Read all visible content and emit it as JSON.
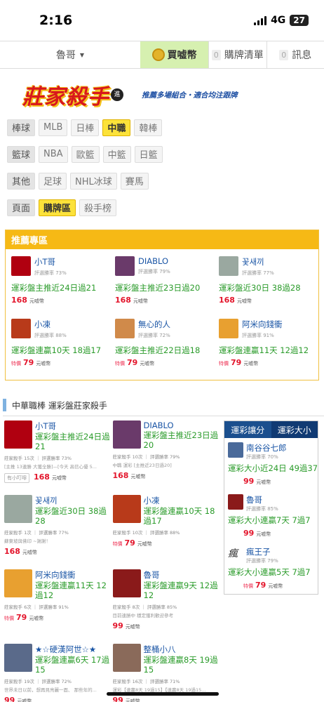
{
  "status": {
    "time": "2:16",
    "network": "4G",
    "battery": "27"
  },
  "nav": {
    "user": "魯哥",
    "buy": "買嘘幣",
    "list_count": "0",
    "list_label": "購牌清單",
    "msg_count": "0",
    "msg_label": "訊息"
  },
  "banner": {
    "logo": "莊家殺手",
    "badge": "進",
    "tagline": "推薦多場組合・適合均注跟牌"
  },
  "categories": [
    {
      "head": "棒球",
      "items": [
        "MLB",
        "日棒",
        "中職",
        "韓棒"
      ],
      "active": "中職"
    },
    {
      "head": "籃球",
      "items": [
        "NBA",
        "歐籃",
        "中籃",
        "日籃"
      ]
    },
    {
      "head": "其他",
      "items": [
        "足球",
        "NHL冰球",
        "賽馬"
      ]
    },
    {
      "head": "頁面",
      "items": [
        "購牌區",
        "殺手榜"
      ],
      "active": "購牌區"
    }
  ],
  "recommend": {
    "title": "推薦專區",
    "special": "特價",
    "unit": "元嘘幣",
    "cards": [
      {
        "name": "小T哥",
        "rate": "評選勝率 73%",
        "title": "運彩盤主推近24日過21",
        "price": "168",
        "special": false,
        "color": "#b00010"
      },
      {
        "name": "DIABLO",
        "rate": "評選勝率 79%",
        "title": "運彩盤主推近23日過20",
        "price": "168",
        "special": false,
        "color": "#6a3a6a"
      },
      {
        "name": "꽃새끼",
        "rate": "評選勝率 77%",
        "title": "運彩盤近30日 38過28",
        "price": "168",
        "special": false,
        "color": "#9aa8a0"
      },
      {
        "name": "小凍",
        "rate": "評選勝率 88%",
        "title": "運彩盤連贏10天 18過17",
        "price": "79",
        "special": true,
        "color": "#b83a1a"
      },
      {
        "name": "無心的人",
        "rate": "評選勝率 72%",
        "title": "運彩盤主推近22日過18",
        "price": "79",
        "special": true,
        "color": "#d08a4a"
      },
      {
        "name": "阿米向錢衝",
        "rate": "評選勝率 91%",
        "title": "運彩盤連贏11天 12過12",
        "price": "79",
        "special": true,
        "color": "#e8a030"
      }
    ]
  },
  "section": {
    "title": "中華職棒 運彩盤莊家殺手"
  },
  "list": {
    "special": "特價",
    "unit": "元嘘幣",
    "rows": [
      [
        {
          "name": "小T哥",
          "title": "運彩盤主推近24日過21",
          "meta": "莊家殺手 15次 ｜ 評選勝率 73%",
          "desc": "[主推 13連勝 大獲全勝]—[今天 高信心優 5...",
          "tag": "有小叮嚀",
          "price": "168",
          "special": false,
          "color": "#b00010"
        },
        {
          "name": "DIABLO",
          "title": "運彩盤主推近23日過20",
          "meta": "莊家殺手 10次 ｜ 評選勝率 79%",
          "desc": "中職 運彩 [主推近23日過20]",
          "tag": "",
          "price": "168",
          "special": false,
          "color": "#6a3a6a"
        }
      ],
      [
        {
          "name": "꽃새끼",
          "title": "運彩盤近30日 38過28",
          "meta": "莊家殺手 1次 ｜ 評選勝率 77%",
          "desc": "蘇東坡與佛印 ~謝謝！",
          "tag": "",
          "price": "168",
          "special": false,
          "color": "#9aa8a0"
        },
        {
          "name": "小凍",
          "title": "運彩盤連贏10天 18過17",
          "meta": "莊家殺手 10次 ｜ 評選勝率 88%",
          "desc": "",
          "tag": "",
          "price": "79",
          "special": true,
          "color": "#b83a1a"
        }
      ],
      [
        {
          "name": "阿米向錢衝",
          "title": "運彩盤連贏11天 12過12",
          "meta": "莊家殺手 6次 ｜ 評選勝率 91%",
          "desc": "",
          "tag": "",
          "price": "79",
          "special": true,
          "color": "#e8a030"
        },
        {
          "name": "魯哥",
          "title": "運彩盤連贏9天 12過12",
          "meta": "莊家殺手 8次 ｜ 評選勝率 85%",
          "desc": "目前連勝中 穩定獲利歡迎參考",
          "tag": "",
          "price": "99",
          "special": false,
          "color": "#8a1a1a"
        }
      ],
      [
        {
          "name": "★☆硬漢阿世☆★",
          "title": "運彩盤連贏6天 17過15",
          "meta": "莊家殺手 19次 ｜ 評選勝率 72%",
          "desc": "世界未日以前，想再見亮麗一面、 那些年的...",
          "tag": "",
          "price": "99",
          "special": false,
          "color": "#5a6a8a"
        },
        {
          "name": "整桶小八",
          "title": "運彩盤連贏8天 19過15",
          "meta": "莊家殺手 16次 ｜ 評選勝率 71%",
          "desc": "運彩【連贏8天 19過15】【連贏8天 19過15...",
          "tag": "",
          "price": "99",
          "special": false,
          "color": "#8a6a5a"
        }
      ]
    ]
  },
  "side": {
    "tabs": [
      "運彩讓分",
      "運彩大小"
    ],
    "special": "特價",
    "unit": "元嘘幣",
    "items": [
      {
        "name": "南谷谷七郎",
        "rate": "評選勝率 70%",
        "title": "運彩大小近24日 49過37",
        "price": "99",
        "special": false,
        "color": "#4a6a9a"
      },
      {
        "name": "魯哥",
        "rate": "評選勝率 85%",
        "title": "運彩大小連贏7天 7過7",
        "price": "99",
        "special": false,
        "color": "#8a1a1a"
      },
      {
        "name": "瘋王子",
        "rate": "評選勝率 79%",
        "title": "運彩大小連贏5天 7過7",
        "price": "79",
        "special": true,
        "color": "#ffffff"
      }
    ]
  },
  "colors": {
    "accent": "#f6b915",
    "link": "#1a55a5",
    "green": "#2a9b2a",
    "price": "#e3152b",
    "tab": "#1b4f8e"
  }
}
